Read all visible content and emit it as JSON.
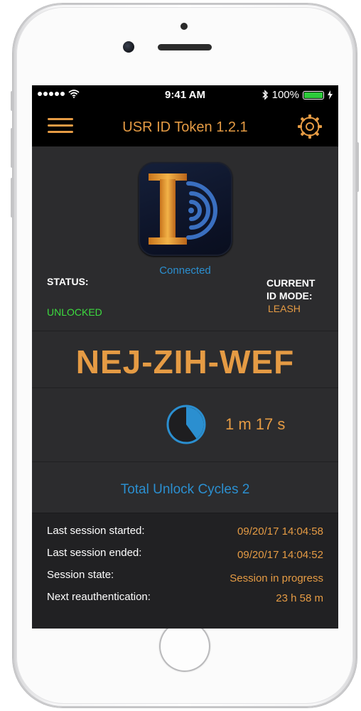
{
  "status_bar": {
    "time": "9:41 AM",
    "battery_percent": "100%",
    "battery_level": 1.0,
    "signal_icon": "signal-dots-icon",
    "wifi_icon": "wifi-icon",
    "bluetooth_icon": "bluetooth-icon",
    "charging_icon": "charging-bolt-icon"
  },
  "nav": {
    "title": "USR ID Token 1.2.1",
    "menu_icon": "hamburger-menu-icon",
    "settings_icon": "gear-icon"
  },
  "device": {
    "connection_status": "Connected",
    "status_label": "STATUS:",
    "status_value": "UNLOCKED",
    "mode_label_line1": "CURRENT",
    "mode_label_line2": "ID MODE:",
    "mode_value": "LEASH"
  },
  "token_code": "NEJ-ZIH-WEF",
  "timer": {
    "remaining": "1 m 17 s",
    "progress_fraction": 0.4
  },
  "cycles_text": "Total Unlock Cycles 2",
  "session": {
    "rows": [
      {
        "label": "Last session started:",
        "value": "09/20/17  14:04:58"
      },
      {
        "label": "Last session ended:",
        "value": "09/20/17  14:04:52"
      },
      {
        "label": "Session state:",
        "value": "Session in progress"
      },
      {
        "label": "Next reauthentication:",
        "value": "23 h 58 m"
      }
    ]
  },
  "colors": {
    "accent_orange": "#e59b44",
    "accent_blue": "#2b8fd0",
    "unlocked_green": "#3ddc3f",
    "screen_background": "#2c2c2e",
    "bar_background": "#000000"
  }
}
